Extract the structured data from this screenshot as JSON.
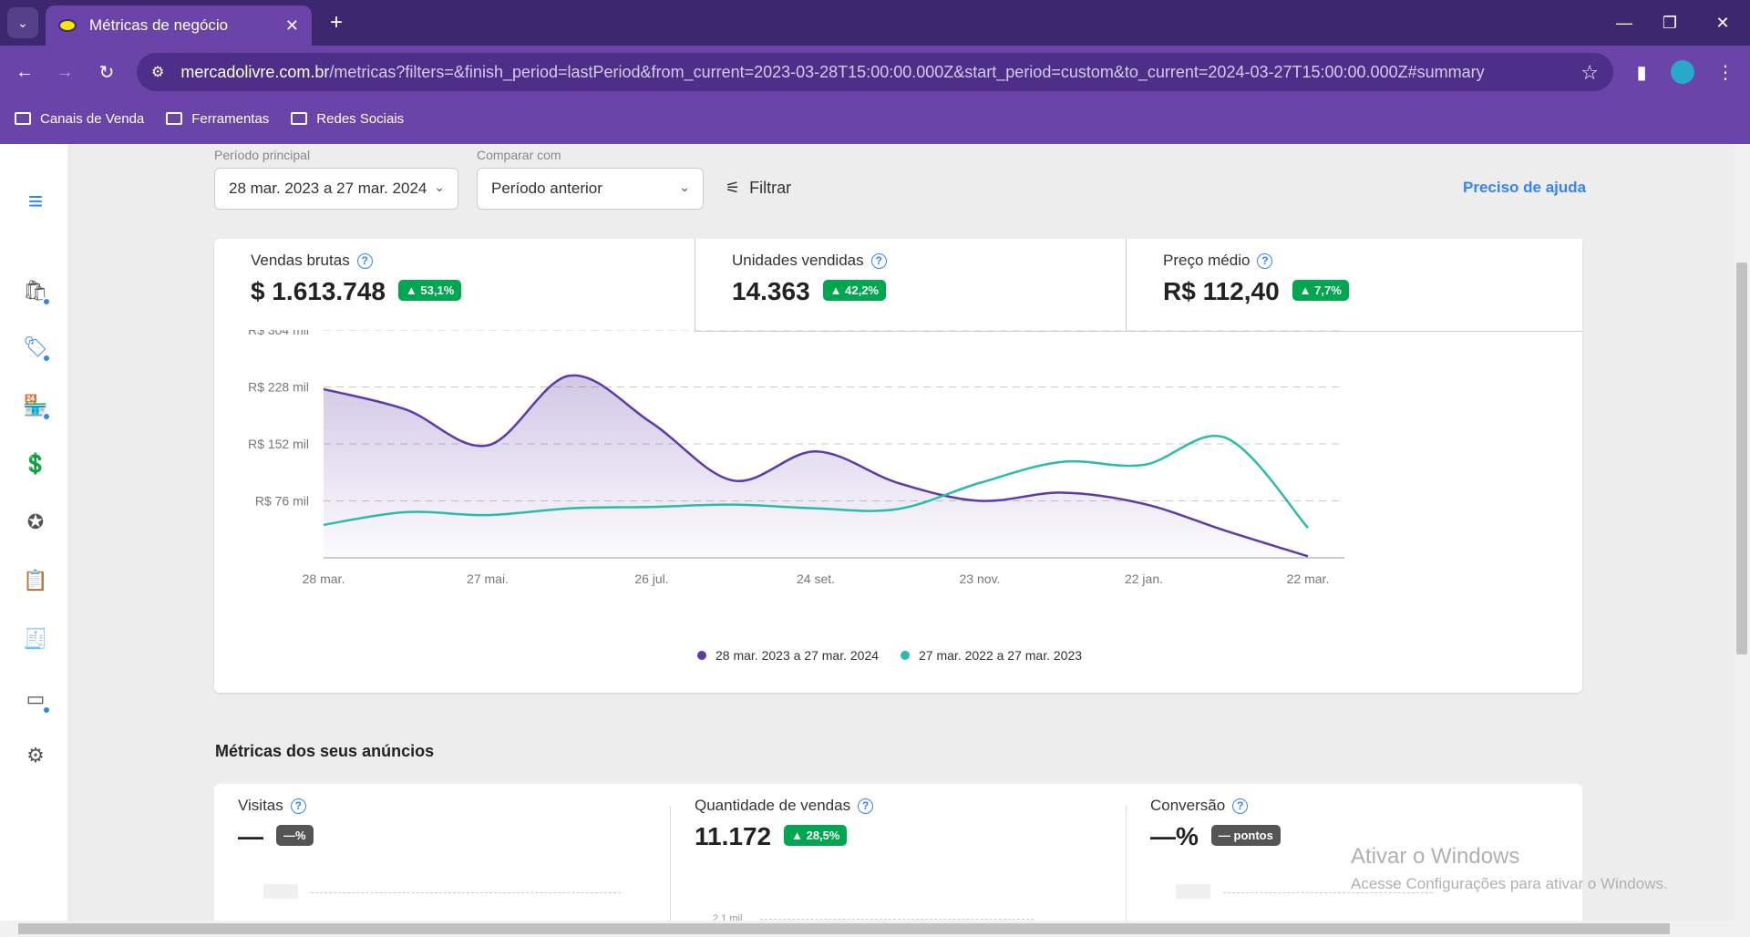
{
  "browser": {
    "tab_title": "Métricas de negócio",
    "url_domain": "mercadolivre.com.br",
    "url_path": "/metricas?filters=&finish_period=lastPeriod&from_current=2023-03-28T15:00:00.000Z&start_period=custom&to_current=2024-03-27T15:00:00.000Z#summary",
    "bookmarks": [
      "Canais de Venda",
      "Ferramentas",
      "Redes Sociais"
    ]
  },
  "filters": {
    "main_period_label": "Período principal",
    "main_period_value": "28 mar. 2023 a 27 mar. 2024",
    "compare_label": "Comparar com",
    "compare_value": "Período anterior",
    "filter_button": "Filtrar",
    "help_link": "Preciso de ajuda"
  },
  "summary": {
    "metrics": [
      {
        "label": "Vendas brutas",
        "value": "$ 1.613.748",
        "change": "▲ 53,1%"
      },
      {
        "label": "Unidades vendidas",
        "value": "14.363",
        "change": "▲ 42,2%"
      },
      {
        "label": "Preço médio",
        "value": "R$ 112,40",
        "change": "▲ 7,7%"
      }
    ]
  },
  "chart_data": {
    "type": "area",
    "y_tick_labels": [
      "R$ 304 mil",
      "R$ 228 mil",
      "R$ 152 mil",
      "R$ 76 mil"
    ],
    "y_ticks": [
      304,
      228,
      152,
      76
    ],
    "ylim": [
      0,
      304
    ],
    "x_tick_labels": [
      "28 mar.",
      "27 mai.",
      "26 jul.",
      "24 set.",
      "23 nov.",
      "22 jan.",
      "22 mar."
    ],
    "xlim": [
      0,
      360
    ],
    "grid": true,
    "legend_position": "bottom",
    "series": [
      {
        "name": "28 mar. 2023 a 27 mar. 2024",
        "color": "#5e3aa8",
        "x": [
          0,
          30,
          60,
          90,
          120,
          150,
          180,
          210,
          240,
          270,
          300,
          330,
          360
        ],
        "values": [
          225,
          198,
          150,
          243,
          180,
          103,
          142,
          100,
          76,
          87,
          72,
          36,
          2
        ]
      },
      {
        "name": "27 mar. 2022 a 27 mar. 2023",
        "color": "#2bbbad",
        "x": [
          0,
          30,
          60,
          90,
          120,
          150,
          180,
          210,
          240,
          270,
          300,
          330,
          360
        ],
        "values": [
          44,
          61,
          57,
          66,
          68,
          71,
          66,
          65,
          100,
          128,
          124,
          160,
          40
        ]
      }
    ]
  },
  "listings": {
    "title": "Métricas dos seus anúncios",
    "metrics": [
      {
        "label": "Visitas",
        "value": "—",
        "change": "—%",
        "change_style": "grey"
      },
      {
        "label": "Quantidade de vendas",
        "value": "11.172",
        "change": "▲ 28,5%",
        "change_style": "green"
      },
      {
        "label": "Conversão",
        "value": "—%",
        "change": "— pontos",
        "change_style": "grey"
      }
    ],
    "mini_tick": "2,1 mil"
  },
  "watermark": {
    "line1": "Ativar o Windows",
    "line2": "Acesse Configurações para ativar o Windows."
  },
  "colors": {
    "accent": "#3483fa",
    "badge_green": "#00a650",
    "browser_purple": "#6a44a8"
  }
}
